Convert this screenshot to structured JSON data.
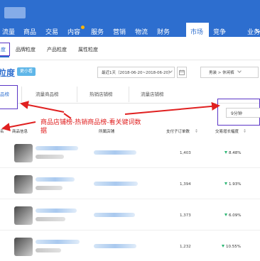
{
  "topnav": {
    "items": [
      "流量",
      "商品",
      "交易",
      "内容",
      "服务",
      "营销",
      "物流",
      "财务"
    ],
    "active": "市场",
    "extra": [
      "竞争",
      "业务"
    ]
  },
  "subtabs": {
    "active": "度",
    "items": [
      "品牌粒度",
      "产品粒度",
      "属性粒度"
    ]
  },
  "section": {
    "title": "粒度",
    "badge": "更小看"
  },
  "date_range": "最近1天（2018-06-20~2018-06-20）",
  "category_select": "男装 > 休闲裤",
  "tabs": {
    "active": "品榜",
    "items": [
      "流量商品榜",
      "热销店铺榜",
      "流量店铺榜"
    ]
  },
  "range_select": "9分钟",
  "annotation": "商品店铺榜-热销商品榜-看关键词数据",
  "table": {
    "side_label": "名",
    "columns": [
      "商品信息",
      "所属店铺",
      "支付子订单数",
      "交易增长幅度"
    ],
    "rows": [
      {
        "paid_orders": "1,403",
        "growth": "8.48%"
      },
      {
        "paid_orders": "1,394",
        "growth": "1.93%"
      },
      {
        "paid_orders": "1,373",
        "growth": "6.09%"
      },
      {
        "paid_orders": "1,232",
        "growth": "10.55%"
      }
    ]
  },
  "colors": {
    "nav_bg": "#2d6ecf",
    "annotation": "#e02020",
    "highlight_box": "#5b35c6",
    "down_trend": "#2bb673"
  }
}
